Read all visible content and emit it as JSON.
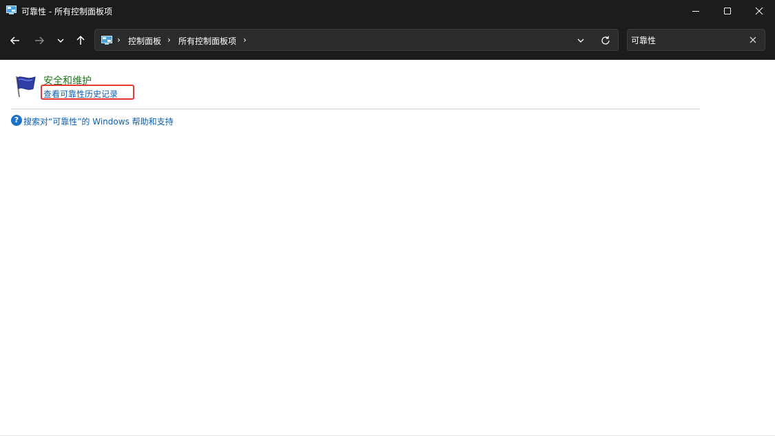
{
  "window": {
    "title": "可靠性 - 所有控制面板项",
    "icon": "control-panel-icon"
  },
  "titlebar_buttons": {
    "minimize": "minimize-icon",
    "maximize": "maximize-icon",
    "close": "close-icon"
  },
  "nav": {
    "back": "arrow-left-icon",
    "forward": "arrow-right-icon",
    "recent": "chevron-down-icon",
    "up": "arrow-up-icon"
  },
  "address": {
    "crumbs": [
      "控制面板",
      "所有控制面板项"
    ],
    "separator": "›"
  },
  "search": {
    "value": "可靠性"
  },
  "results": {
    "section_title": "安全和维护",
    "task_link": "查看可靠性历史记录",
    "help_link": "搜索对“可靠性”的 Windows 帮助和支持",
    "help_glyph": "?"
  },
  "colors": {
    "titlebar": "#1c1c1c",
    "section_title": "#1e7b1e",
    "link": "#0b5fb5",
    "highlight": "#e53935"
  }
}
